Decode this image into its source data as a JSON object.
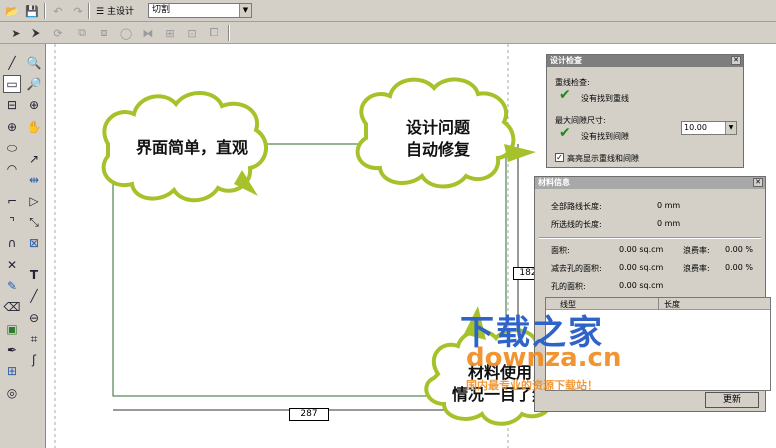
{
  "toolbar": {
    "master_label": "主设计",
    "mode_value": "切割"
  },
  "bubbles": {
    "left_text": "界面简单，直观",
    "top_text_line1": "设计问题",
    "top_text_line2": "自动修复",
    "bottom_text_line1": "材料使用",
    "bottom_text_line2": "情况一目了然"
  },
  "canvas": {
    "dim_vertical": "182",
    "dim_horizontal": "287"
  },
  "design_check_panel": {
    "title": "设计检查",
    "overlap_check_label": "重线检查:",
    "overlap_result": "没有找到重线",
    "min_gap_label": "最大间隙尺寸:",
    "min_gap_value": "10.00",
    "gap_result": "没有找到间隙",
    "highlight_label": "高亮显示重线和间隙"
  },
  "material_panel": {
    "title": "材料信息",
    "total_path_label": "全部路线长度:",
    "total_path_value": "0 mm",
    "selected_len_label": "所选线的长度:",
    "selected_len_value": "0 mm",
    "area_label": "面积:",
    "area_value": "0.00 sq.cm",
    "waste1_label": "浪费率:",
    "waste1_value": "0.00 %",
    "net_area_label": "减去孔的面积:",
    "net_area_value": "0.00 sq.cm",
    "waste2_label": "浪费率:",
    "waste2_value": "0.00 %",
    "hole_area_label": "孔的面积:",
    "hole_area_value": "0.00 sq.cm",
    "table_columns": [
      "线型",
      "长度"
    ],
    "refresh_label": "更新"
  },
  "watermark": {
    "brand": "下载之家",
    "domain": "downza.cn",
    "slogan": "国内最专业的资源下载站！"
  },
  "colors": {
    "bubble_fill": "#ffffff",
    "bubble_stroke": "#a6c22a",
    "watermark_blue": "#2f63c8",
    "watermark_orange": "#f08a1c",
    "check_green": "#1e8a1e"
  }
}
